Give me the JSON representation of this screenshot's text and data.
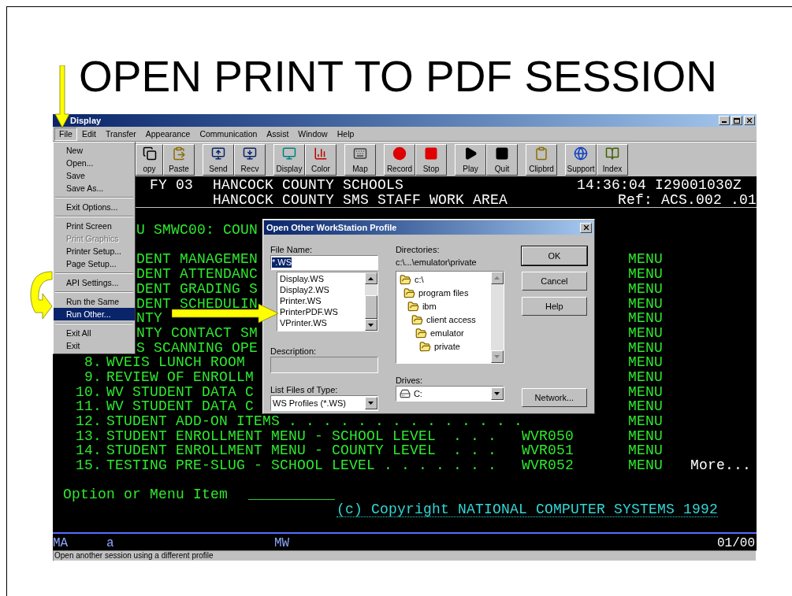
{
  "slide": {
    "title": "OPEN PRINT TO PDF SESSION"
  },
  "window": {
    "title": "Display"
  },
  "menu_bar": [
    {
      "label": "File",
      "selected": true
    },
    {
      "label": "Edit",
      "selected": false
    },
    {
      "label": "Transfer",
      "selected": false
    },
    {
      "label": "Appearance",
      "selected": false
    },
    {
      "label": "Communication",
      "selected": false
    },
    {
      "label": "Assist",
      "selected": false
    },
    {
      "label": "Window",
      "selected": false
    },
    {
      "label": "Help",
      "selected": false
    }
  ],
  "file_menu": [
    {
      "kind": "item",
      "label": "New",
      "disabled": false,
      "selected": false
    },
    {
      "kind": "item",
      "label": "Open...",
      "disabled": false,
      "selected": false
    },
    {
      "kind": "item",
      "label": "Save",
      "disabled": false,
      "selected": false
    },
    {
      "kind": "item",
      "label": "Save As...",
      "disabled": false,
      "selected": false
    },
    {
      "kind": "separator"
    },
    {
      "kind": "item",
      "label": "Exit Options...",
      "disabled": false,
      "selected": false
    },
    {
      "kind": "separator"
    },
    {
      "kind": "item",
      "label": "Print Screen",
      "disabled": false,
      "selected": false
    },
    {
      "kind": "item",
      "label": "Print Graphics",
      "disabled": true,
      "selected": false
    },
    {
      "kind": "item",
      "label": "Printer Setup...",
      "disabled": false,
      "selected": false
    },
    {
      "kind": "item",
      "label": "Page Setup...",
      "disabled": false,
      "selected": false
    },
    {
      "kind": "separator"
    },
    {
      "kind": "item",
      "label": "API Settings...",
      "disabled": false,
      "selected": false
    },
    {
      "kind": "separator"
    },
    {
      "kind": "item",
      "label": "Run the Same",
      "disabled": false,
      "selected": false
    },
    {
      "kind": "item",
      "label": "Run Other...",
      "disabled": false,
      "selected": true
    },
    {
      "kind": "separator"
    },
    {
      "kind": "item",
      "label": "Exit All",
      "disabled": false,
      "selected": false
    },
    {
      "kind": "item",
      "label": "Exit",
      "disabled": false,
      "selected": false
    }
  ],
  "toolbar": {
    "groups": [
      [
        {
          "label": "opy",
          "kind": "copy"
        },
        {
          "label": "Paste",
          "kind": "paste"
        }
      ],
      [
        {
          "label": "Send",
          "kind": "send"
        },
        {
          "label": "Recv",
          "kind": "receive"
        }
      ],
      [
        {
          "label": "Display",
          "kind": "display"
        },
        {
          "label": "Color",
          "kind": "color"
        }
      ],
      [
        {
          "label": "Map",
          "kind": "map"
        }
      ],
      [
        {
          "label": "Record",
          "kind": "record"
        },
        {
          "label": "Stop",
          "kind": "stop"
        }
      ],
      [
        {
          "label": "Play",
          "kind": "play"
        },
        {
          "label": "Quit",
          "kind": "quit"
        }
      ],
      [
        {
          "label": "Clipbrd",
          "kind": "clipboard"
        }
      ],
      [
        {
          "label": "Support",
          "kind": "support"
        },
        {
          "label": "Index",
          "kind": "index"
        }
      ]
    ]
  },
  "terminal": {
    "header": [
      [
        {
          "kind": "fiscal-year",
          "text": "FY 03"
        },
        {
          "kind": "heading",
          "text": "HANCOCK COUNTY SCHOOLS"
        },
        {
          "kind": "clock",
          "text": "14:36:04 I29001030Z"
        }
      ],
      [
        {
          "kind": "heading",
          "text": "HANCOCK COUNTY SMS STAFF WORK AREA"
        },
        {
          "kind": "reference",
          "text": "Ref: ACS.002 .01"
        }
      ]
    ],
    "title_line": [
      {
        "kind": "fragment",
        "text": "U SMWC00: COUN"
      }
    ],
    "options": [
      [
        {
          "kind": "fragment",
          "text": "DENT MANAGEMEN"
        },
        {
          "kind": "type",
          "text": "MENU"
        }
      ],
      [
        {
          "kind": "fragment",
          "text": "DENT ATTENDANC"
        },
        {
          "kind": "type",
          "text": "MENU"
        }
      ],
      [
        {
          "kind": "fragment",
          "text": "DENT GRADING S"
        },
        {
          "kind": "type",
          "text": "MENU"
        }
      ],
      [
        {
          "kind": "fragment",
          "text": "DENT SCHEDULIN"
        },
        {
          "kind": "type",
          "text": "MENU"
        }
      ],
      [
        {
          "kind": "fragment",
          "text": "NTY"
        },
        {
          "kind": "type",
          "text": "MENU"
        }
      ],
      [
        {
          "kind": "fragment",
          "text": "NTY CONTACT SM"
        },
        {
          "kind": "type",
          "text": "MENU"
        }
      ],
      [
        {
          "kind": "fragment",
          "text": "S SCANNING OPE"
        },
        {
          "kind": "type",
          "text": "MENU"
        }
      ],
      [
        {
          "kind": "number",
          "text": "8."
        },
        {
          "kind": "title",
          "text": "WVEIS LUNCH ROOM"
        },
        {
          "kind": "type",
          "text": "MENU"
        }
      ],
      [
        {
          "kind": "number",
          "text": "9."
        },
        {
          "kind": "title",
          "text": "REVIEW OF ENROLLM"
        },
        {
          "kind": "type",
          "text": "MENU"
        }
      ],
      [
        {
          "kind": "number",
          "text": "10."
        },
        {
          "kind": "title",
          "text": "WV STUDENT DATA C"
        },
        {
          "kind": "type",
          "text": "MENU"
        }
      ],
      [
        {
          "kind": "number",
          "text": "11."
        },
        {
          "kind": "title",
          "text": "WV STUDENT DATA C"
        },
        {
          "kind": "type",
          "text": "MENU"
        }
      ],
      [
        {
          "kind": "number",
          "text": "12."
        },
        {
          "kind": "title",
          "text": "STUDENT ADD-ON ITEMS . . . . . . . . . . . . . ."
        },
        {
          "kind": "type",
          "text": "MENU"
        }
      ],
      [
        {
          "kind": "number",
          "text": "13."
        },
        {
          "kind": "title",
          "text": "STUDENT ENROLLMENT MENU - SCHOOL LEVEL  . . ."
        },
        {
          "kind": "program",
          "text": "WVR050"
        },
        {
          "kind": "type",
          "text": "MENU"
        }
      ],
      [
        {
          "kind": "number",
          "text": "14."
        },
        {
          "kind": "title",
          "text": "STUDENT ENROLLMENT MENU - COUNTY LEVEL  . . ."
        },
        {
          "kind": "program",
          "text": "WVR051"
        },
        {
          "kind": "type",
          "text": "MENU"
        }
      ],
      [
        {
          "kind": "number",
          "text": "15."
        },
        {
          "kind": "title",
          "text": "TESTING PRE-SLUG - SCHOOL LEVEL . . . . . . ."
        },
        {
          "kind": "program",
          "text": "WVR052"
        },
        {
          "kind": "type",
          "text": "MENU"
        },
        {
          "kind": "more",
          "text": "More..."
        }
      ]
    ],
    "prompt": {
      "label": "Option or Menu Item",
      "value": "__________"
    },
    "copyright": "(c) Copyright NATIONAL COMPUTER SYSTEMS 1992"
  },
  "terminal_status": [
    "MA",
    "a",
    "MW",
    "01/00"
  ],
  "status_bar": "Open another session using a different profile",
  "dialog": {
    "title": "Open Other WorkStation Profile",
    "file_name": {
      "label": "File Name:",
      "value": "*.WS",
      "files": [
        "Display.WS",
        "Display2.WS",
        "Printer.WS",
        "PrinterPDF.WS",
        "VPrinter.WS"
      ]
    },
    "directories": {
      "label": "Directories:",
      "path": "c:\\...\\emulator\\private",
      "tree": [
        {
          "label": "c:\\",
          "children": [
            {
              "label": "program files",
              "children": [
                {
                  "label": "ibm",
                  "children": [
                    {
                      "label": "client access",
                      "children": [
                        {
                          "label": "emulator",
                          "children": [
                            {
                              "label": "private"
                            }
                          ]
                        }
                      ]
                    }
                  ]
                }
              ]
            }
          ]
        }
      ]
    },
    "description": {
      "label": "Description:"
    },
    "file_type": {
      "label": "List Files of Type:",
      "value": "WS Profiles (*.WS)"
    },
    "drives": {
      "label": "Drives:",
      "value": "C:"
    },
    "buttons": [
      "OK",
      "Cancel",
      "Help",
      "Network..."
    ]
  }
}
